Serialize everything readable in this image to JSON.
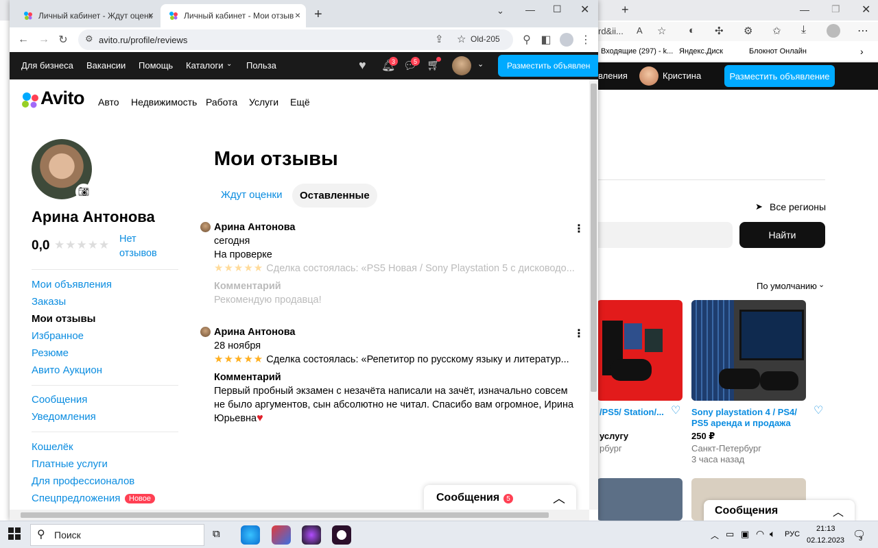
{
  "bg": {
    "addr_text": "rd&ii...",
    "bookmarks": [
      "Входящие (297) - k...",
      "Яндекс.Диск",
      "Блокнот Онлайн"
    ],
    "nav_partial": "вления",
    "user": "Кристина",
    "post_button": "Разместить объявление",
    "regions": "Все регионы",
    "find_button": "Найти",
    "sort": "По умолчанию",
    "cards": [
      {
        "title": "/PS5/ Station/...",
        "price": "услугу",
        "city": "рбург"
      },
      {
        "title": "Sony playstation 4 / PS4/ PS5 аренда и продажа",
        "price": "250 ₽",
        "city": "Санкт-Петербург",
        "time": "3 часа назад"
      }
    ],
    "messages": "Сообщения"
  },
  "browser": {
    "tabs": [
      {
        "label": "Личный кабинет - Ждут оценк"
      },
      {
        "label": "Личный кабинет - Мои отзыв"
      }
    ],
    "url": "avito.ru/profile/reviews",
    "profile_chip": "Old-205"
  },
  "site_nav": {
    "links": [
      "Для бизнеса",
      "Вакансии",
      "Помощь",
      "Каталоги",
      "Польза"
    ],
    "notif_count": "3",
    "msg_count": "5",
    "post_button": "Разместить объявлен"
  },
  "header": {
    "logo": "Avito",
    "categories": [
      "Авто",
      "Недвижимость",
      "Работа",
      "Услуги",
      "Ещё"
    ]
  },
  "profile": {
    "name": "Арина Антонова",
    "rating": "0,0",
    "no_reviews": "Нет отзывов"
  },
  "menu": {
    "group1": [
      "Мои объявления",
      "Заказы",
      "Мои отзывы",
      "Избранное",
      "Резюме",
      "Авито Аукцион"
    ],
    "group2": [
      "Сообщения",
      "Уведомления"
    ],
    "group3": [
      "Кошелёк",
      "Платные услуги",
      "Для профессионалов",
      "Спецпредложения"
    ],
    "new_badge": "Новое"
  },
  "page": {
    "title": "Мои отзывы",
    "tabs": [
      "Ждут оценки",
      "Оставленные"
    ]
  },
  "reviews": [
    {
      "author": "Арина Антонова",
      "date": "сегодня",
      "status": "На проверке",
      "stars": "★★★★★",
      "deal": "Сделка состоялась: «PS5 Новая / Sony Playstation 5 с дисководо...",
      "comment_label": "Комментарий",
      "comment": "Рекомендую продавца!"
    },
    {
      "author": "Арина Антонова",
      "date": "28 ноября",
      "stars": "★★★★★",
      "deal": "Сделка состоялась: «Репетитор по русскому языку и литератур...",
      "comment_label": "Комментарий",
      "comment_lines": [
        "Первый пробный экзамен с незачёта написали на зачёт, изначально совсем",
        "не было аргументов, сын абсолютно не читал. Спасибо вам огромное, Ирина",
        "Юрьевна"
      ]
    }
  ],
  "messages_widget": {
    "label": "Сообщения",
    "count": "5"
  },
  "taskbar": {
    "search": "Поиск",
    "lang": "РУС",
    "time": "21:13",
    "date": "02.12.2023",
    "notif": "3"
  }
}
